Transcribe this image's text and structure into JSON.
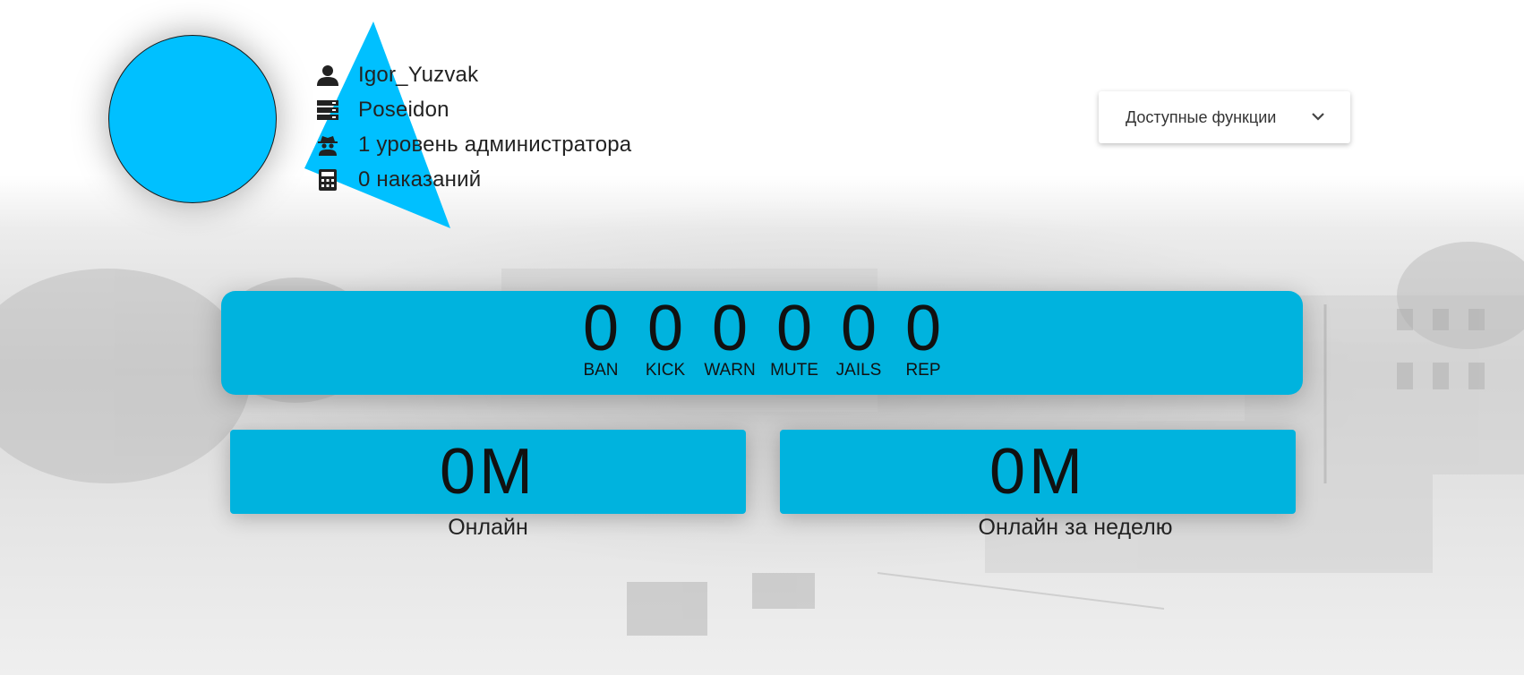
{
  "profile": {
    "username": "Igor_Yuzvak",
    "server": "Poseidon",
    "admin_level": "1 уровень администратора",
    "punishments": "0 наказаний",
    "accent_color": "#00c0ff"
  },
  "icons": {
    "user": "user-icon",
    "server": "server-icon",
    "admin": "spy-icon",
    "punishments": "calculator-icon",
    "dropdown": "chevron-down-icon"
  },
  "menu": {
    "label": "Доступные функции"
  },
  "stats": [
    {
      "value": "0",
      "label": "BAN"
    },
    {
      "value": "0",
      "label": "KICK"
    },
    {
      "value": "0",
      "label": "WARN"
    },
    {
      "value": "0",
      "label": "MUTE"
    },
    {
      "value": "0",
      "label": "JAILS"
    },
    {
      "value": "0",
      "label": "REP"
    }
  ],
  "online": {
    "total_value": "0M",
    "total_label": "Онлайн",
    "week_value": "0M",
    "week_label": "Онлайн за неделю"
  },
  "colors": {
    "panel": "#00b3de",
    "avatar": "#00c0ff"
  }
}
